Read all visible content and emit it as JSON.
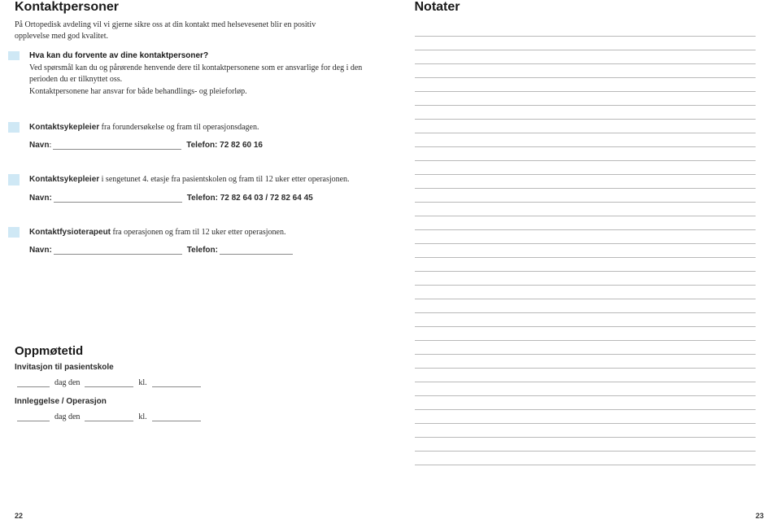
{
  "left": {
    "title": "Kontaktpersoner",
    "intro": "På Ortopedisk avdeling vil vi gjerne sikre oss at din kontakt med helsevesenet blir en positiv opplevelse med god kvalitet.",
    "expect_heading": "Hva kan du forvente av dine kontaktpersoner?",
    "expect_p1": "Ved spørsmål kan du og pårørende henvende dere til kontaktpersonene som er ansvarlige for deg i den perioden du er tilknyttet oss.",
    "expect_p2": "Kontaktpersonene har ansvar for både behandlings- og pleieforløp.",
    "c1_role": "Kontaktsykepleier",
    "c1_desc": " fra forundersøkelse og fram til operasjonsdagen.",
    "c1_name_label": "Navn",
    "c1_tel_label": "Telefon: 72 82 60 16",
    "c2_role": "Kontaktsykepleier",
    "c2_desc": " i sengetunet 4. etasje fra pasientskolen og fram til 12 uker etter operasjonen.",
    "c2_name_label": "Navn:",
    "c2_tel_label": "Telefon: 72 82 64 03 / 72 82 64 45",
    "c3_role": "Kontaktfysioterapeut",
    "c3_desc": " fra operasjonen og fram til 12 uker etter operasjonen.",
    "c3_name_label": "Navn:",
    "c3_tel_label": "Telefon:",
    "opp_title": "Oppmøtetid",
    "inv_heading": "Invitasjon til pasientskole",
    "dag_den": "dag den",
    "kl": "kl.",
    "inn_heading": "Innleggelse / Operasjon",
    "page_num": "22"
  },
  "right": {
    "title": "Notater",
    "page_num": "23"
  }
}
